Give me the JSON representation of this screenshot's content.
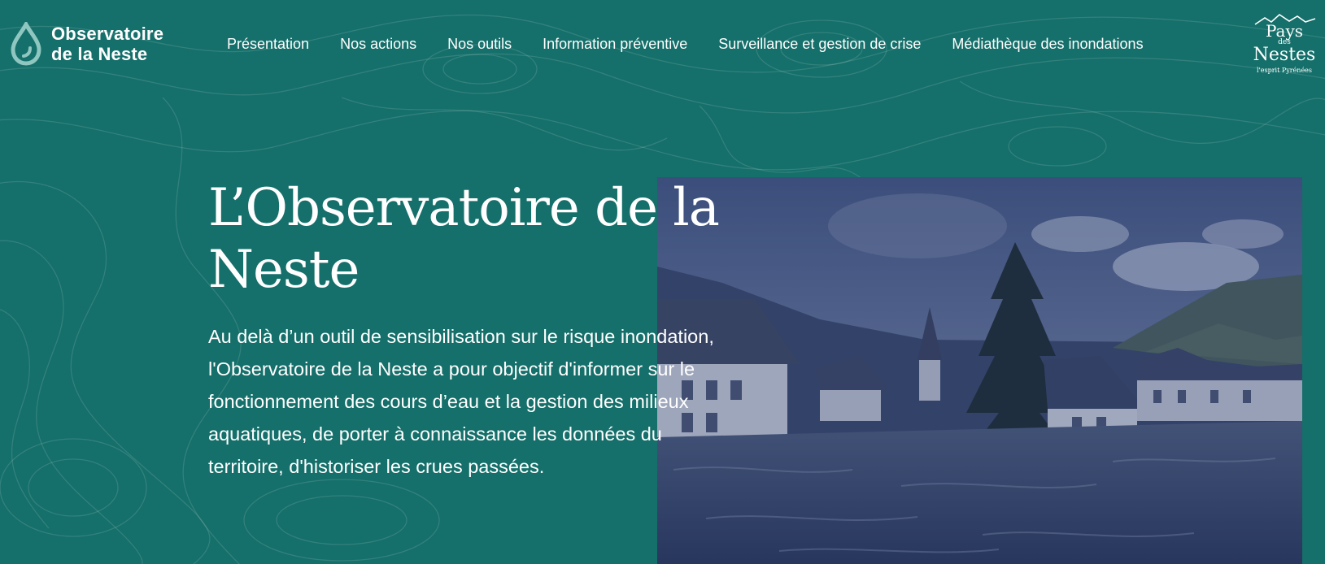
{
  "brand": {
    "line1": "Observatoire",
    "line2": "de la Neste"
  },
  "nav": {
    "items": [
      {
        "label": "Présentation"
      },
      {
        "label": "Nos actions"
      },
      {
        "label": "Nos outils"
      },
      {
        "label": "Information préventive"
      },
      {
        "label": "Surveillance et gestion de crise"
      },
      {
        "label": "Médiathèque des inondations"
      }
    ]
  },
  "partner_logo": {
    "line1": "Pays",
    "line2": "des",
    "line3": "Nestes",
    "tagline": "l'esprit Pyrénées"
  },
  "hero": {
    "title": "L’Observatoire de la Neste",
    "text": "Au delà d’un outil de sensibilisation sur le risque inondation, l'Observatoire de la Neste a pour objectif d'informer sur le fonctionnement des cours d’eau et la gestion des milieux aquatiques, de porter à connaissance les données du territoire, d'historiser les crues passées."
  },
  "colors": {
    "background": "#156f6a",
    "photo_overlay": "#2b3e6e",
    "text": "#ffffff"
  }
}
